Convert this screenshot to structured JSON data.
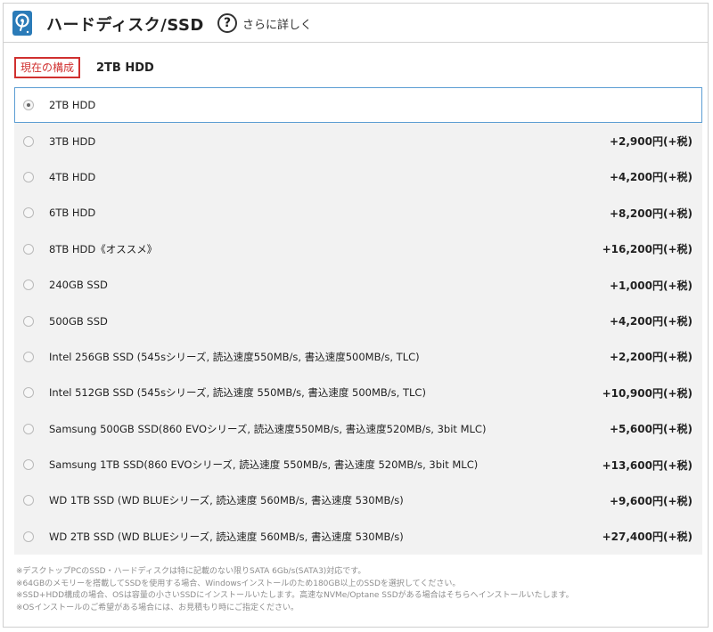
{
  "header": {
    "title": "ハードディスク/SSD",
    "help_label": "さらに詳しく",
    "help_glyph": "?",
    "icon": "hard-disk-icon"
  },
  "current": {
    "badge": "現在の構成",
    "value": "2TB HDD"
  },
  "options": [
    {
      "label": "2TB HDD",
      "price": "",
      "selected": true
    },
    {
      "label": "3TB HDD",
      "price": "+2,900円(+税)",
      "selected": false
    },
    {
      "label": "4TB HDD",
      "price": "+4,200円(+税)",
      "selected": false
    },
    {
      "label": "6TB HDD",
      "price": "+8,200円(+税)",
      "selected": false
    },
    {
      "label": "8TB HDD《オススメ》",
      "price": "+16,200円(+税)",
      "selected": false
    },
    {
      "label": "240GB SSD",
      "price": "+1,000円(+税)",
      "selected": false
    },
    {
      "label": "500GB SSD",
      "price": "+4,200円(+税)",
      "selected": false
    },
    {
      "label": "Intel 256GB SSD (545sシリーズ, 読込速度550MB/s, 書込速度500MB/s, TLC)",
      "price": "+2,200円(+税)",
      "selected": false
    },
    {
      "label": "Intel 512GB SSD (545sシリーズ, 読込速度 550MB/s, 書込速度 500MB/s, TLC)",
      "price": "+10,900円(+税)",
      "selected": false
    },
    {
      "label": "Samsung 500GB SSD(860 EVOシリーズ, 読込速度550MB/s, 書込速度520MB/s, 3bit MLC)",
      "price": "+5,600円(+税)",
      "selected": false
    },
    {
      "label": "Samsung 1TB SSD(860 EVOシリーズ, 読込速度 550MB/s, 書込速度 520MB/s, 3bit MLC)",
      "price": "+13,600円(+税)",
      "selected": false
    },
    {
      "label": "WD 1TB SSD (WD BLUEシリーズ, 読込速度 560MB/s, 書込速度 530MB/s)",
      "price": "+9,600円(+税)",
      "selected": false
    },
    {
      "label": "WD 2TB SSD (WD BLUEシリーズ, 読込速度 560MB/s, 書込速度 530MB/s)",
      "price": "+27,400円(+税)",
      "selected": false
    }
  ],
  "notes": [
    "※デスクトップPCのSSD・ハードディスクは特に記載のない限りSATA 6Gb/s(SATA3)対応です。",
    "※64GBのメモリーを搭載してSSDを使用する場合、Windowsインストールのため180GB以上のSSDを選択してください。",
    "※SSD+HDD構成の場合、OSは容量の小さいSSDにインストールいたします。高速なNVMe/Optane SSDがある場合はそちらへインストールいたします。",
    "※OSインストールのご希望がある場合には、お見積もり時にご指定ください。"
  ],
  "colors": {
    "accent": "#2b7bb8",
    "badge_red": "#d0302f",
    "selected_border": "#5b9dd3",
    "row_bg": "#f2f2f2"
  }
}
